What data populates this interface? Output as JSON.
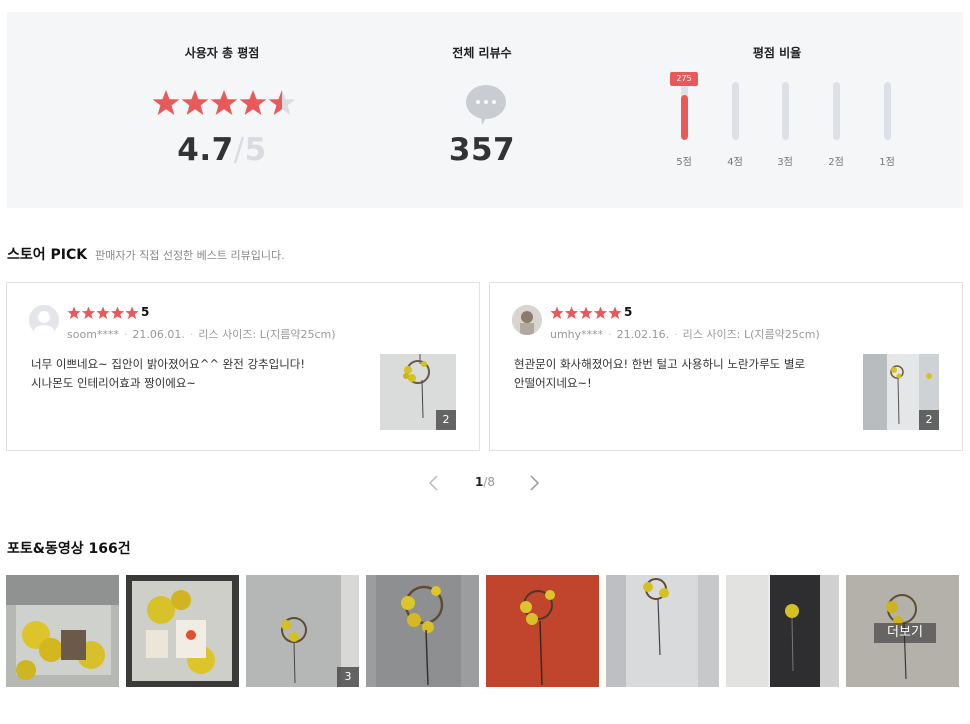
{
  "summary": {
    "rating_title": "사용자 총 평점",
    "rating_value": "4.7",
    "rating_slash": "/",
    "rating_max": "5",
    "rating_fraction": 0.94,
    "count_title": "전체 리뷰수",
    "count_value": "357",
    "ratio_title": "평점 비율",
    "ratio_bars": [
      {
        "label": "5점",
        "fill": 0.77,
        "tip": "275"
      },
      {
        "label": "4점",
        "fill": 0.0,
        "tip": ""
      },
      {
        "label": "3점",
        "fill": 0.0,
        "tip": ""
      },
      {
        "label": "2점",
        "fill": 0.0,
        "tip": ""
      },
      {
        "label": "1점",
        "fill": 0.0,
        "tip": ""
      }
    ],
    "accent_color": "#e8595a"
  },
  "pick": {
    "title": "스토어 PICK",
    "description": "판매자가 직접 선정한 베스트 리뷰입니다.",
    "reviews": [
      {
        "rating": "5",
        "user": "soom****",
        "date": "21.06.01.",
        "option": "리스 사이즈: L(지름약25cm)",
        "text_line1": "너무 이쁘네요~ 집안이 밝아졌어요^^ 완전 강추입니다!",
        "text_line2": "시나몬도 인테리어효과 짱이에요~",
        "photo_count": "2"
      },
      {
        "rating": "5",
        "user": "umhy****",
        "date": "21.02.16.",
        "option": "리스 사이즈: L(지름약25cm)",
        "text_line1": "현관문이 화사해졌어요! 한번 털고 사용하니 노란가루도 별로",
        "text_line2": "안떨어지네요~!",
        "photo_count": "2"
      }
    ]
  },
  "pager": {
    "current": "1",
    "separator": "/",
    "total": "8"
  },
  "photos": {
    "title": "포토&동영상 166건",
    "third_count": "3",
    "more_label": "더보기"
  }
}
